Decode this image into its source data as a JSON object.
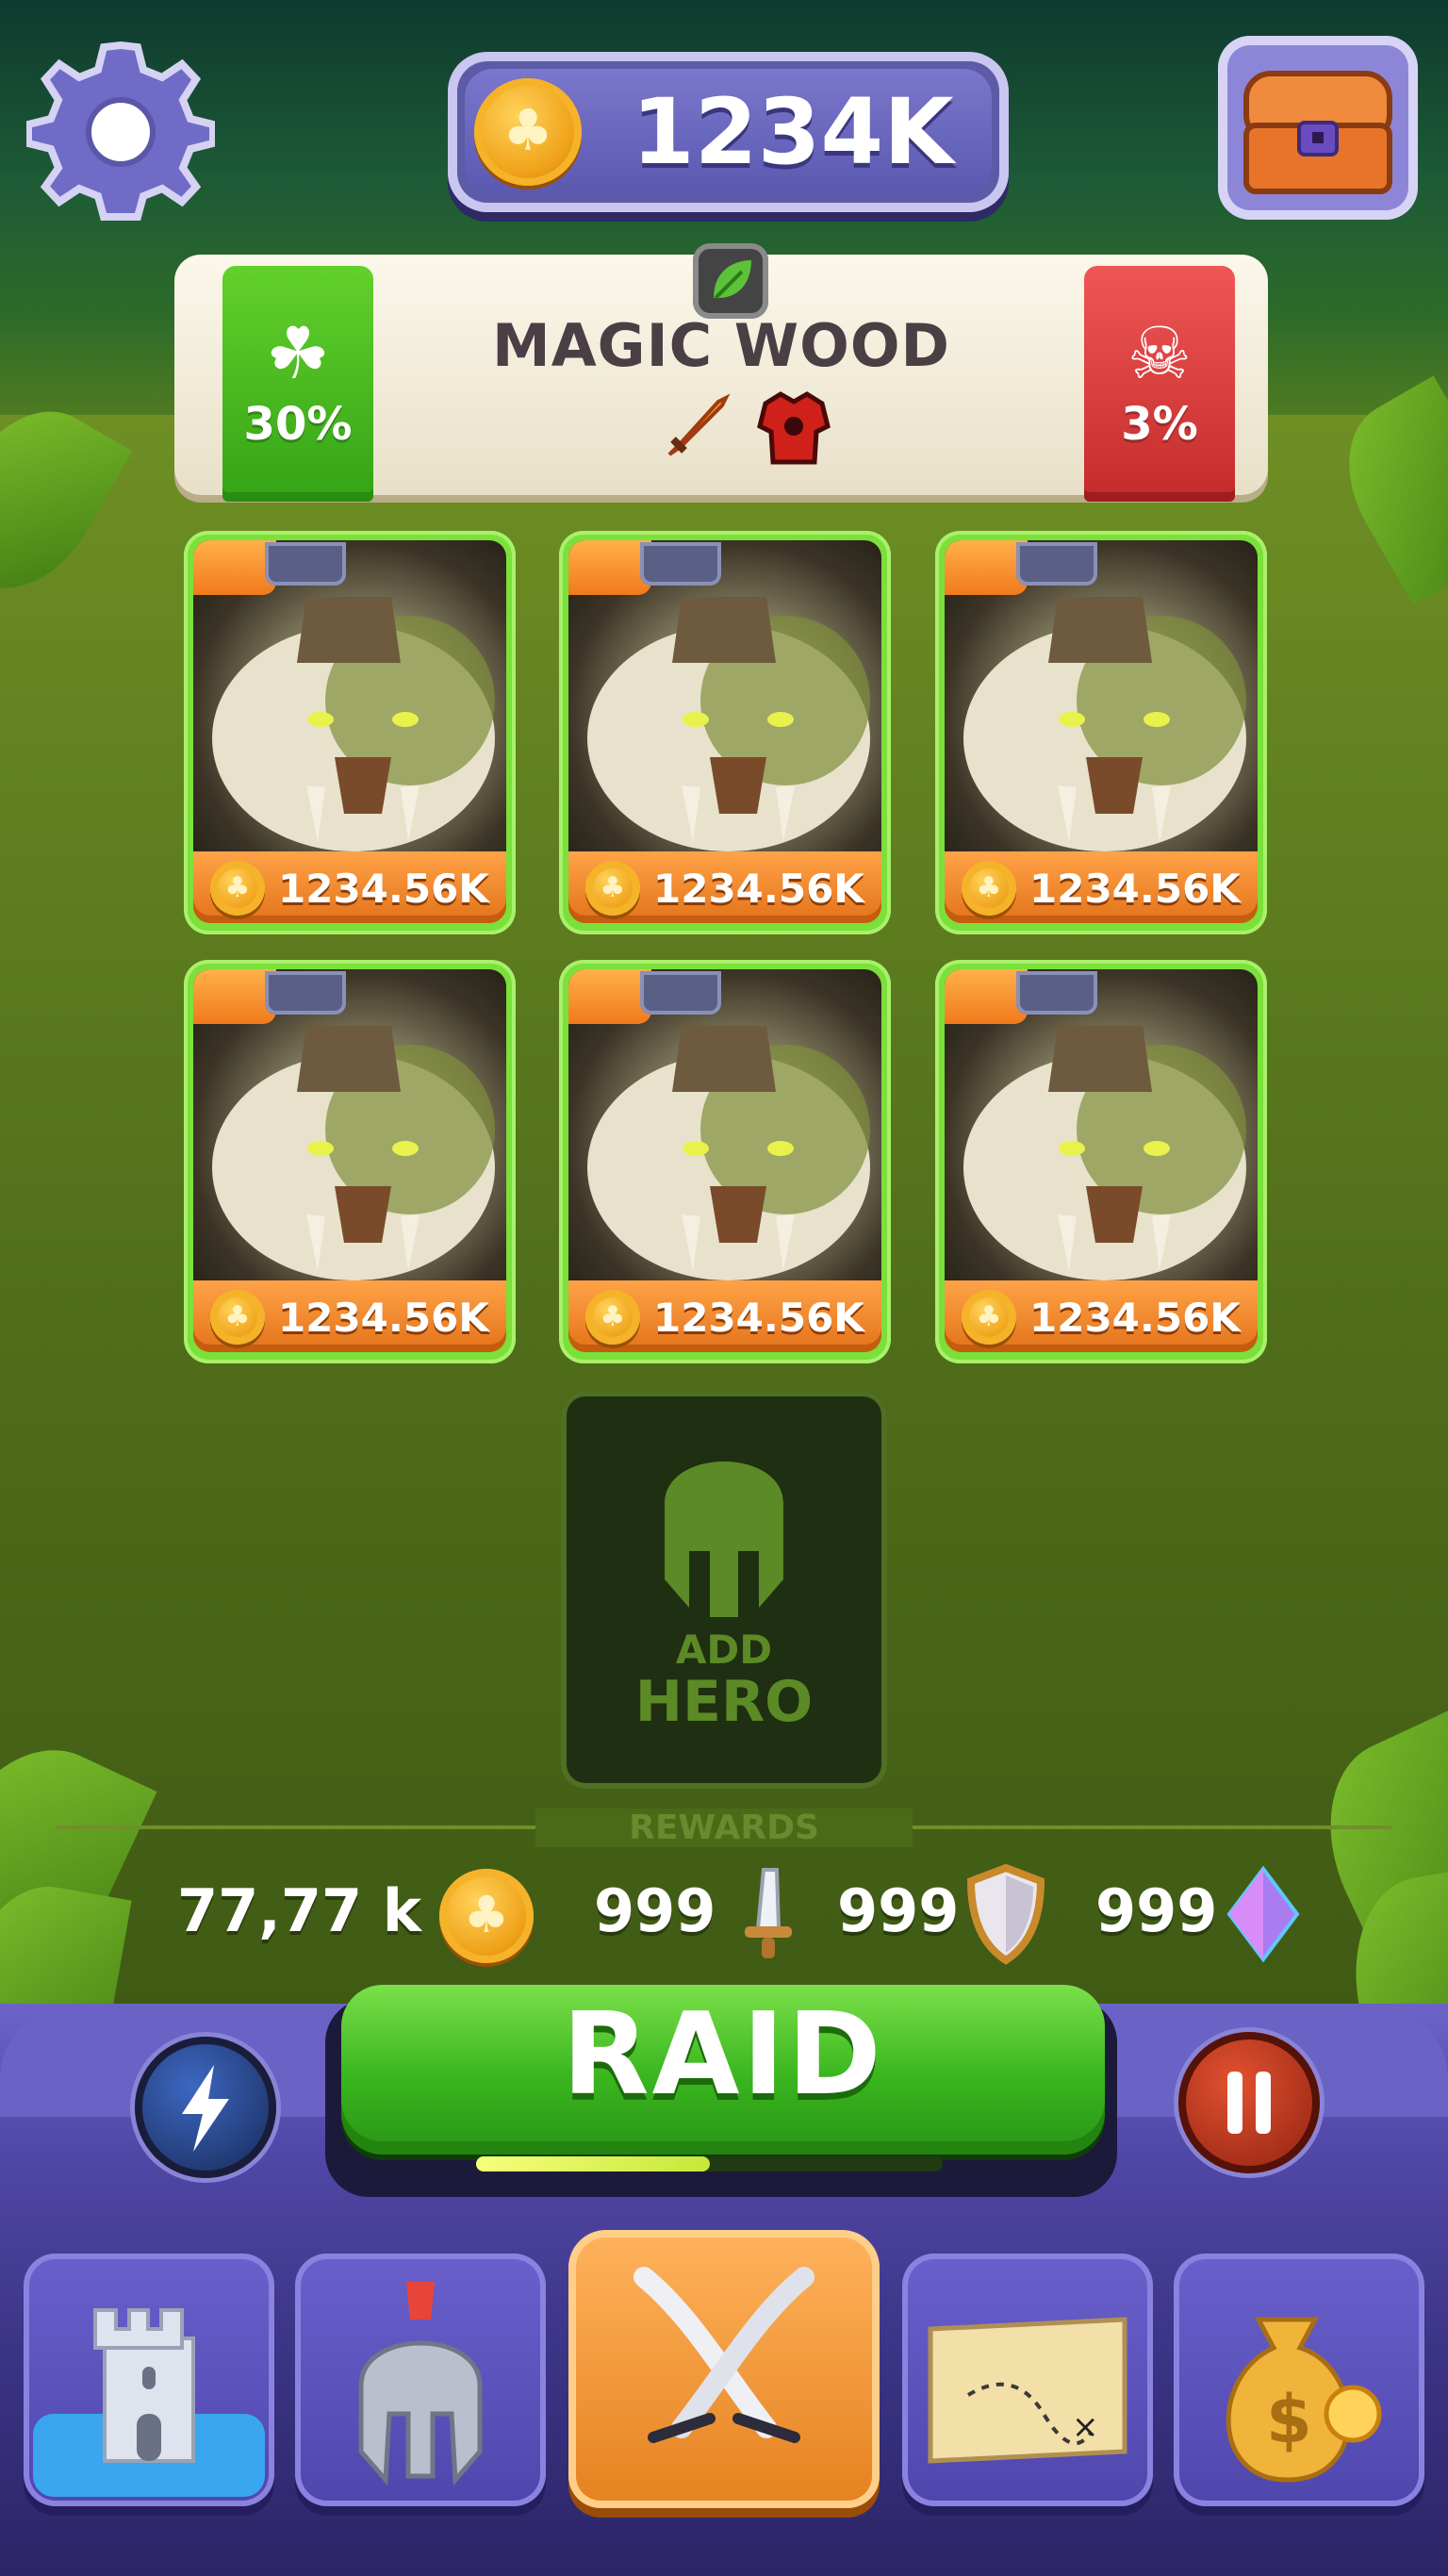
{
  "header": {
    "coin_balance": "1234K",
    "icons": [
      "gear-icon",
      "coin-icon",
      "treasure-chest-icon"
    ]
  },
  "area": {
    "title": "MAGIC WOOD",
    "luck_percent": "30%",
    "death_percent": "3%",
    "icons": [
      "leaf-icon",
      "clover-icon",
      "skull-icon",
      "fire-sword-icon",
      "red-armor-icon"
    ]
  },
  "heroes": [
    {
      "price": "1234.56K"
    },
    {
      "price": "1234.56K"
    },
    {
      "price": "1234.56K"
    },
    {
      "price": "1234.56K"
    },
    {
      "price": "1234.56K"
    },
    {
      "price": "1234.56K"
    }
  ],
  "add_hero": {
    "line1": "ADD",
    "line2": "HERO"
  },
  "rewards": {
    "label": "REWARDS",
    "coins": "77,77 k",
    "swords": "999",
    "shields": "999",
    "gems": "999"
  },
  "raid": {
    "label": "RAID",
    "progress": 0.5
  },
  "nav": {
    "items": [
      "castle-icon",
      "spartan-helmet-icon",
      "crossed-swords-icon",
      "treasure-map-icon",
      "money-bag-icon"
    ],
    "active_index": 2
  },
  "colors": {
    "accent_green": "#39b51e",
    "panel_purple": "#5248a8",
    "active_orange": "#e5811f",
    "price_orange": "#e3721a"
  }
}
